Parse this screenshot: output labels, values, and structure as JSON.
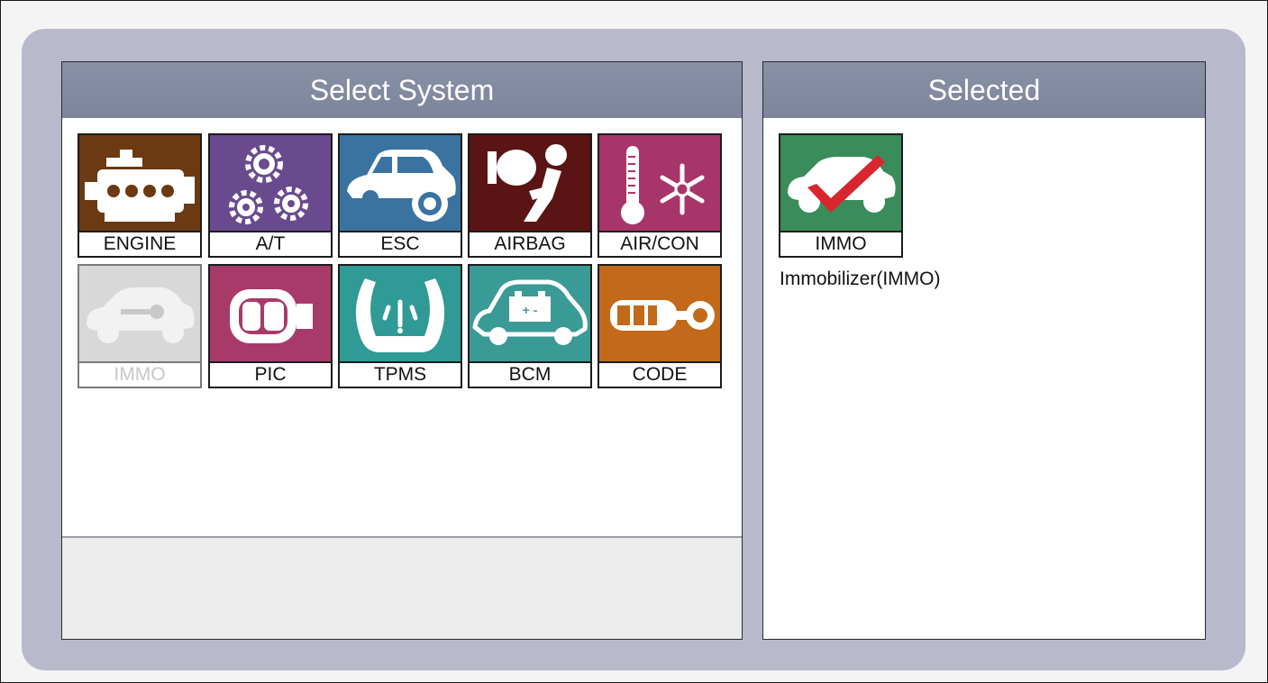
{
  "select_panel": {
    "title": "Select System",
    "systems": [
      {
        "label": "ENGINE",
        "icon": "engine-icon",
        "color": "#6b3a12",
        "enabled": true
      },
      {
        "label": "A/T",
        "icon": "gears-icon",
        "color": "#6a4a8e",
        "enabled": true
      },
      {
        "label": "ESC",
        "icon": "car-brake-icon",
        "color": "#3a72a0",
        "enabled": true
      },
      {
        "label": "AIRBAG",
        "icon": "airbag-icon",
        "color": "#5a1414",
        "enabled": true
      },
      {
        "label": "AIR/CON",
        "icon": "thermometer-snowflake-icon",
        "color": "#a7356a",
        "enabled": true
      },
      {
        "label": "IMMO",
        "icon": "car-key-icon",
        "color": "#d8d8d8",
        "enabled": false
      },
      {
        "label": "PIC",
        "icon": "smart-key-icon",
        "color": "#a83a6a",
        "enabled": true
      },
      {
        "label": "TPMS",
        "icon": "tire-pressure-icon",
        "color": "#2f9a96",
        "enabled": true
      },
      {
        "label": "BCM",
        "icon": "car-battery-icon",
        "color": "#3a9a96",
        "enabled": true
      },
      {
        "label": "CODE",
        "icon": "key-fob-icon",
        "color": "#c26a1a",
        "enabled": true
      }
    ]
  },
  "selected_panel": {
    "title": "Selected",
    "item": {
      "label": "IMMO",
      "icon": "car-checkmark-icon",
      "color": "#3a8c5a"
    },
    "description": "Immobilizer(IMMO)"
  }
}
